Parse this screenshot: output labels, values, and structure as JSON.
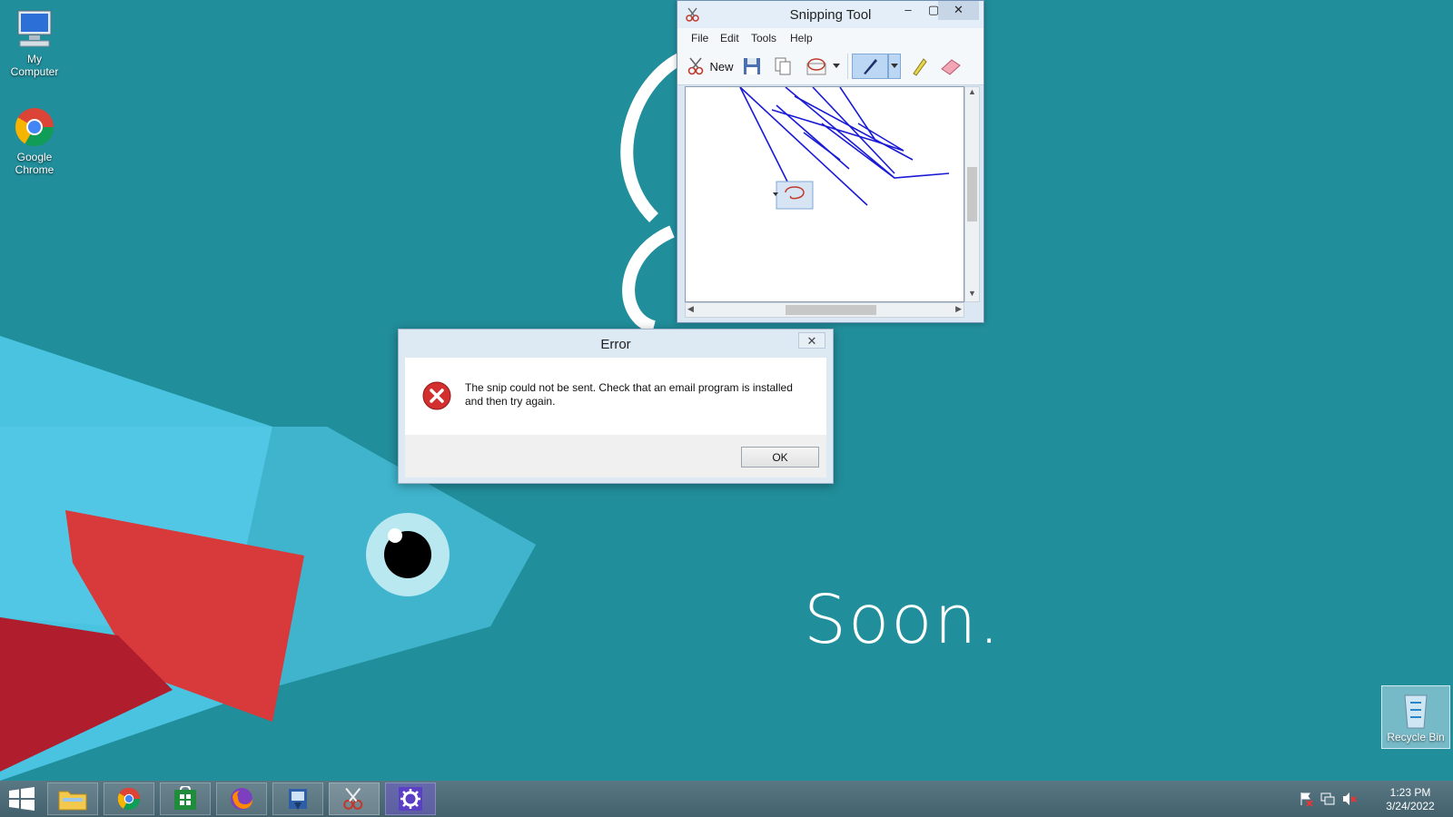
{
  "desktop": {
    "icons": [
      {
        "label_line1": "My",
        "label_line2": "Computer",
        "icon": "computer-icon"
      },
      {
        "label_line1": "Google",
        "label_line2": "Chrome",
        "icon": "chrome-icon"
      }
    ],
    "recycle_bin_label": "Recycle Bin",
    "wallpaper_text": "Soon."
  },
  "snipping_tool": {
    "title": "Snipping Tool",
    "window_controls": {
      "minimize": "–",
      "maximize": "▢",
      "close": "✕"
    },
    "menu": [
      "File",
      "Edit",
      "Tools",
      "Help"
    ],
    "toolbar": {
      "new_label": "New"
    },
    "toolbar_icons": [
      "scissors-icon",
      "save-icon",
      "copy-icon",
      "send-snip-icon",
      "dropdown-arrow-icon",
      "pen-icon",
      "highlighter-icon",
      "eraser-icon"
    ]
  },
  "error_dialog": {
    "title": "Error",
    "close": "✕",
    "message_line1": "The snip could not be sent. Check that an email program is installed",
    "message_line2": "and then try again.",
    "ok_label": "OK"
  },
  "taskbar": {
    "apps": [
      "start-icon",
      "file-explorer-icon",
      "chrome-icon",
      "store-icon",
      "firefox-icon",
      "app-icon",
      "snipping-tool-icon",
      "settings-icon"
    ],
    "time": "1:23 PM",
    "date": "3/24/2022"
  },
  "colors": {
    "desktop_bg": "#218e9b",
    "pen_ink": "#1a1ad6",
    "error_red": "#d32f2f"
  }
}
